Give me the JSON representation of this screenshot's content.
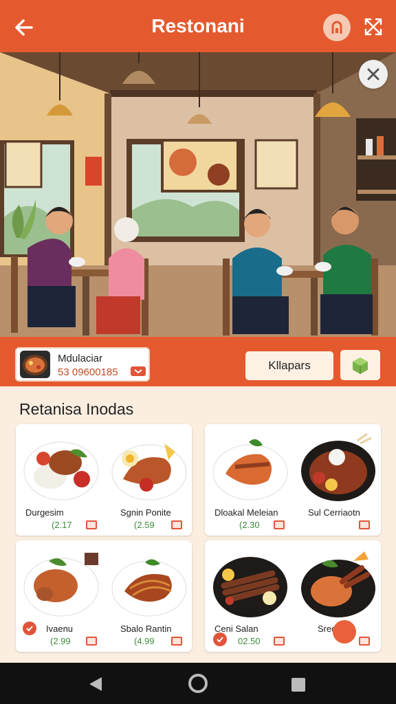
{
  "header": {
    "title": "Restonani"
  },
  "restaurant": {
    "name": "Mdulaciar",
    "code": "53 09600185"
  },
  "actions": {
    "primary_label": "Kllapars"
  },
  "section": {
    "title": "Retanisa Inodas"
  },
  "dishes": [
    {
      "name": "Durgesim",
      "price": "(2.17"
    },
    {
      "name": "Sgnin Ponite",
      "price": "(2.59"
    },
    {
      "name": "Dloakal Meleian",
      "price": "(2.30"
    },
    {
      "name": "Sul Cerriaotn",
      "price": ""
    },
    {
      "name": "Ivaenu",
      "price": "(2.99"
    },
    {
      "name": "Sbalo Rantin",
      "price": "(4.99"
    },
    {
      "name": "Ceni Salan",
      "price": "02.50"
    },
    {
      "name": "Sredooo",
      "price": ""
    }
  ],
  "colors": {
    "accent": "#e45a2e",
    "price": "#3c8a3c",
    "background": "#fbeee0"
  },
  "icons": [
    "back-arrow-icon",
    "lock-icon",
    "expand-icon",
    "close-icon",
    "box-icon",
    "check-icon",
    "nav-back-icon",
    "nav-home-icon",
    "nav-recents-icon"
  ]
}
